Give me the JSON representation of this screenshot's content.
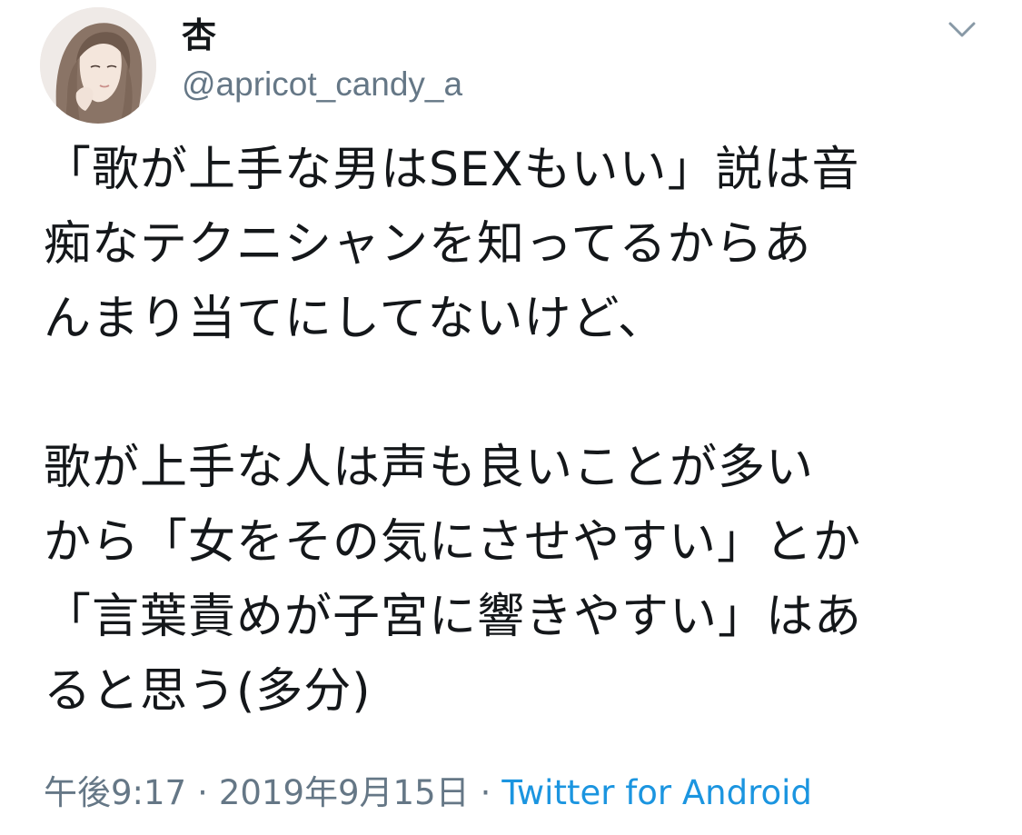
{
  "author": {
    "display_name": "杏",
    "handle": "@apricot_candy_a"
  },
  "icons": {
    "avatar": "avatar-illustration",
    "menu": "chevron-down-icon"
  },
  "tweet": {
    "lines": [
      "「歌が上手な男はSEXもいい」説は音",
      "痴なテクニシャンを知ってるからあ",
      "んまり当てにしてないけど、",
      "",
      "歌が上手な人は声も良いことが多い",
      "から「女をその気にさせやすい」とか",
      "「言葉責めが子宮に響きやすい」はあ",
      "ると思う(多分)"
    ]
  },
  "meta": {
    "time": "午後9:17",
    "separator": "·",
    "date": "2019年9月15日",
    "source": "Twitter for Android"
  },
  "colors": {
    "text": "#14171a",
    "secondary": "#657786",
    "link": "#1b95e0"
  }
}
